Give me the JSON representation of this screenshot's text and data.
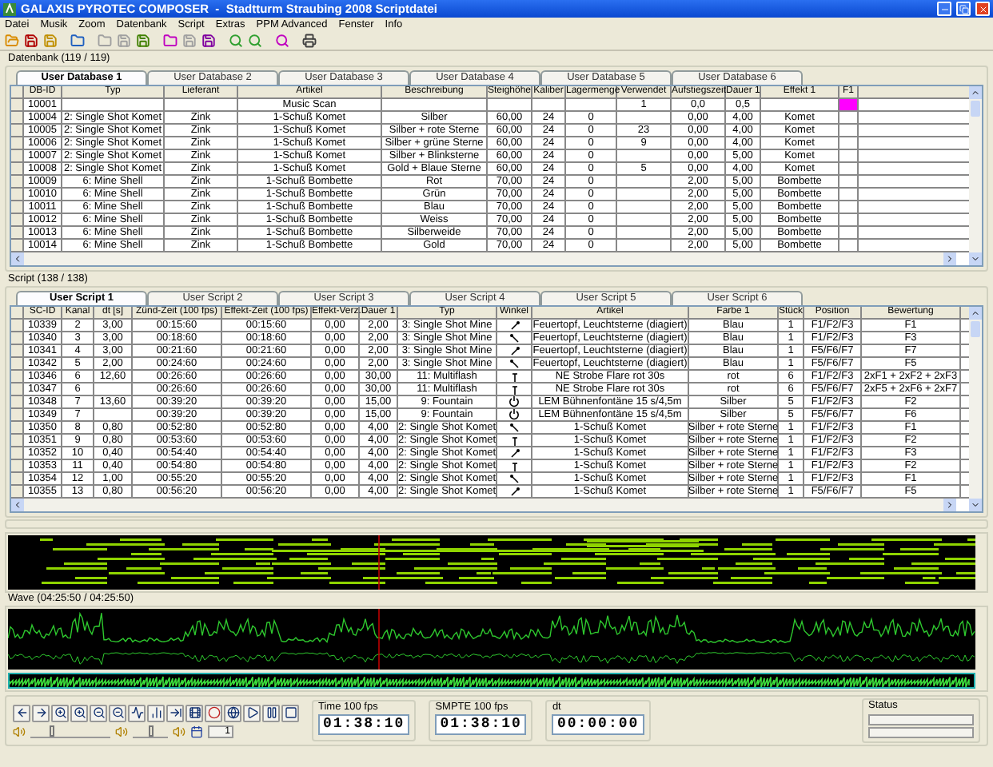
{
  "window": {
    "title": "GALAXIS PYROTEC COMPOSER  -  Stadtturm Straubing 2008 Scriptdatei"
  },
  "menu": [
    "Datei",
    "Musik",
    "Zoom",
    "Datenbank",
    "Script",
    "Extras",
    "PPM Advanced",
    "Fenster",
    "Info"
  ],
  "database": {
    "title": "Datenbank (119 / 119)",
    "tabs": [
      {
        "label": "User Database 1",
        "selected": true
      },
      {
        "label": "User Database 2",
        "selected": false
      },
      {
        "label": "User Database 3",
        "selected": false
      },
      {
        "label": "User Database 4",
        "selected": false
      },
      {
        "label": "User Database 5",
        "selected": false
      },
      {
        "label": "User Database 6",
        "selected": false
      }
    ],
    "columns": [
      "DB-ID",
      "Typ",
      "Lieferant",
      "Artikel",
      "Beschreibung",
      "Steighöhe",
      "Kaliber",
      "Lagermenge",
      "Verwendet",
      "Aufstiegszeit",
      "Dauer 1",
      "Effekt 1",
      "F1"
    ],
    "rows": [
      {
        "cells": [
          "10001",
          "",
          "",
          "Music Scan",
          "",
          "",
          "",
          "",
          "1",
          "0,0",
          "0,5",
          "",
          ""
        ],
        "color": "#ff00ff"
      },
      {
        "cells": [
          "10004",
          "2: Single Shot Komet",
          "Zink",
          "1-Schuß Komet",
          "Silber",
          "60,00",
          "24",
          "0",
          "",
          "0,00",
          "4,00",
          "Komet",
          ""
        ]
      },
      {
        "cells": [
          "10005",
          "2: Single Shot Komet",
          "Zink",
          "1-Schuß Komet",
          "Silber + rote Sterne",
          "60,00",
          "24",
          "0",
          "23",
          "0,00",
          "4,00",
          "Komet",
          ""
        ]
      },
      {
        "cells": [
          "10006",
          "2: Single Shot Komet",
          "Zink",
          "1-Schuß Komet",
          "Silber + grüne Sterne",
          "60,00",
          "24",
          "0",
          "9",
          "0,00",
          "4,00",
          "Komet",
          ""
        ]
      },
      {
        "cells": [
          "10007",
          "2: Single Shot Komet",
          "Zink",
          "1-Schuß Komet",
          "Silber + Blinksterne",
          "60,00",
          "24",
          "0",
          "",
          "0,00",
          "5,00",
          "Komet",
          ""
        ]
      },
      {
        "cells": [
          "10008",
          "2: Single Shot Komet",
          "Zink",
          "1-Schuß Komet",
          "Gold + Blaue Sterne",
          "60,00",
          "24",
          "0",
          "5",
          "0,00",
          "4,00",
          "Komet",
          ""
        ]
      },
      {
        "cells": [
          "10009",
          "6: Mine Shell",
          "Zink",
          "1-Schuß Bombette",
          "Rot",
          "70,00",
          "24",
          "0",
          "",
          "2,00",
          "5,00",
          "Bombette",
          ""
        ]
      },
      {
        "cells": [
          "10010",
          "6: Mine Shell",
          "Zink",
          "1-Schuß Bombette",
          "Grün",
          "70,00",
          "24",
          "0",
          "",
          "2,00",
          "5,00",
          "Bombette",
          ""
        ]
      },
      {
        "cells": [
          "10011",
          "6: Mine Shell",
          "Zink",
          "1-Schuß Bombette",
          "Blau",
          "70,00",
          "24",
          "0",
          "",
          "2,00",
          "5,00",
          "Bombette",
          ""
        ]
      },
      {
        "cells": [
          "10012",
          "6: Mine Shell",
          "Zink",
          "1-Schuß Bombette",
          "Weiss",
          "70,00",
          "24",
          "0",
          "",
          "2,00",
          "5,00",
          "Bombette",
          ""
        ]
      },
      {
        "cells": [
          "10013",
          "6: Mine Shell",
          "Zink",
          "1-Schuß Bombette",
          "Silberweide",
          "70,00",
          "24",
          "0",
          "",
          "2,00",
          "5,00",
          "Bombette",
          ""
        ]
      },
      {
        "cells": [
          "10014",
          "6: Mine Shell",
          "Zink",
          "1-Schuß Bombette",
          "Gold",
          "70,00",
          "24",
          "0",
          "",
          "2,00",
          "5,00",
          "Bombette",
          ""
        ]
      }
    ]
  },
  "script": {
    "title": "Script (138 / 138)",
    "tabs": [
      {
        "label": "User Script 1",
        "selected": true
      },
      {
        "label": "User Script 2",
        "selected": false
      },
      {
        "label": "User Script 3",
        "selected": false
      },
      {
        "label": "User Script 4",
        "selected": false
      },
      {
        "label": "User Script 5",
        "selected": false
      },
      {
        "label": "User Script 6",
        "selected": false
      }
    ],
    "columns": [
      "SC-ID",
      "Kanal",
      "dt [s]",
      "Zünd-Zeit (100 fps)",
      "Effekt-Zeit (100 fps)",
      "Effekt-Verz.",
      "Dauer 1",
      "Typ",
      "Winkel",
      "Artikel",
      "Farbe 1",
      "Stück",
      "Position",
      "Bewertung"
    ],
    "rows": [
      {
        "cells": [
          "10339",
          "2",
          "3,00",
          "00:15:60",
          "00:15:60",
          "0,00",
          "2,00",
          "3: Single Shot Mine",
          "",
          "Feuertopf, Leuchtsterne (diagiert)",
          "Blau",
          "1",
          "F1/F2/F3",
          "F1"
        ],
        "kind": "right"
      },
      {
        "cells": [
          "10340",
          "3",
          "3,00",
          "00:18:60",
          "00:18:60",
          "0,00",
          "2,00",
          "3: Single Shot Mine",
          "",
          "Feuertopf, Leuchtsterne (diagiert)",
          "Blau",
          "1",
          "F1/F2/F3",
          "F3"
        ],
        "kind": "left"
      },
      {
        "cells": [
          "10341",
          "4",
          "3,00",
          "00:21:60",
          "00:21:60",
          "0,00",
          "2,00",
          "3: Single Shot Mine",
          "",
          "Feuertopf, Leuchtsterne (diagiert)",
          "Blau",
          "1",
          "F5/F6/F7",
          "F7"
        ],
        "kind": "right"
      },
      {
        "cells": [
          "10342",
          "5",
          "2,00",
          "00:24:60",
          "00:24:60",
          "0,00",
          "2,00",
          "3: Single Shot Mine",
          "",
          "Feuertopf, Leuchtsterne (diagiert)",
          "Blau",
          "1",
          "F5/F6/F7",
          "F5"
        ],
        "kind": "left"
      },
      {
        "cells": [
          "10346",
          "6",
          "12,60",
          "00:26:60",
          "00:26:60",
          "0,00",
          "30,00",
          "11: Multiflash",
          "",
          "NE Strobe Flare rot 30s",
          "rot",
          "6",
          "F1/F2/F3",
          "2xF1 + 2xF2 + 2xF3"
        ],
        "kind": "up"
      },
      {
        "cells": [
          "10347",
          "6",
          "",
          "00:26:60",
          "00:26:60",
          "0,00",
          "30,00",
          "11: Multiflash",
          "",
          "NE Strobe Flare rot 30s",
          "rot",
          "6",
          "F5/F6/F7",
          "2xF5 + 2xF6 + 2xF7"
        ],
        "kind": "up"
      },
      {
        "cells": [
          "10348",
          "7",
          "13,60",
          "00:39:20",
          "00:39:20",
          "0,00",
          "15,00",
          "9: Fountain",
          "",
          "LEM Bühnenfontäne 15 s/4,5m",
          "Silber",
          "5",
          "F1/F2/F3",
          "F2"
        ],
        "kind": "spin"
      },
      {
        "cells": [
          "10349",
          "7",
          "",
          "00:39:20",
          "00:39:20",
          "0,00",
          "15,00",
          "9: Fountain",
          "",
          "LEM Bühnenfontäne 15 s/4,5m",
          "Silber",
          "5",
          "F5/F6/F7",
          "F6"
        ],
        "kind": "spin"
      },
      {
        "cells": [
          "10350",
          "8",
          "0,80",
          "00:52:80",
          "00:52:80",
          "0,00",
          "4,00",
          "2: Single Shot Komet",
          "",
          "1-Schuß Komet",
          "Silber + rote Sterne",
          "1",
          "F1/F2/F3",
          "F1"
        ],
        "kind": "left"
      },
      {
        "cells": [
          "10351",
          "9",
          "0,80",
          "00:53:60",
          "00:53:60",
          "0,00",
          "4,00",
          "2: Single Shot Komet",
          "",
          "1-Schuß Komet",
          "Silber + rote Sterne",
          "1",
          "F1/F2/F3",
          "F2"
        ],
        "kind": "up"
      },
      {
        "cells": [
          "10352",
          "10",
          "0,40",
          "00:54:40",
          "00:54:40",
          "0,00",
          "4,00",
          "2: Single Shot Komet",
          "",
          "1-Schuß Komet",
          "Silber + rote Sterne",
          "1",
          "F1/F2/F3",
          "F3"
        ],
        "kind": "right"
      },
      {
        "cells": [
          "10353",
          "11",
          "0,40",
          "00:54:80",
          "00:54:80",
          "0,00",
          "4,00",
          "2: Single Shot Komet",
          "",
          "1-Schuß Komet",
          "Silber + rote Sterne",
          "1",
          "F1/F2/F3",
          "F2"
        ],
        "kind": "up"
      },
      {
        "cells": [
          "10354",
          "12",
          "1,00",
          "00:55:20",
          "00:55:20",
          "0,00",
          "4,00",
          "2: Single Shot Komet",
          "",
          "1-Schuß Komet",
          "Silber + rote Sterne",
          "1",
          "F1/F2/F3",
          "F1"
        ],
        "kind": "left"
      },
      {
        "cells": [
          "10355",
          "13",
          "0,80",
          "00:56:20",
          "00:56:20",
          "0,00",
          "4,00",
          "2: Single Shot Komet",
          "",
          "1-Schuß Komet",
          "Silber + rote Sterne",
          "1",
          "F5/F6/F7",
          "F5"
        ],
        "kind": "right"
      }
    ]
  },
  "wave": {
    "title": "Wave (04:25:50 / 04:25:50)"
  },
  "transport": {
    "volume": {
      "level": 0.25
    },
    "balance": {
      "level": 0.5
    },
    "step": "1"
  },
  "time": {
    "label": "Time 100 fps",
    "value": "01:38:10"
  },
  "smpte": {
    "label": "SMPTE 100 fps",
    "value": "01:38:10"
  },
  "dt": {
    "label": "dt",
    "value": "00:00:00"
  },
  "status": {
    "label": "Status"
  }
}
